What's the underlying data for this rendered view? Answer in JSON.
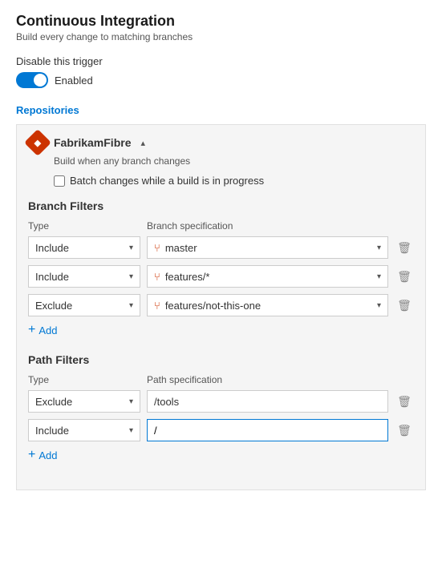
{
  "header": {
    "title": "Continuous Integration",
    "subtitle": "Build every change to matching branches"
  },
  "disable_trigger": {
    "label": "Disable this trigger",
    "toggle_state": "Enabled"
  },
  "repositories_section": {
    "label": "Repositories"
  },
  "repo": {
    "name": "FabrikamFibre",
    "description": "Build when any branch changes",
    "batch_label": "Batch changes while a build is in progress",
    "branch_filters_title": "Branch Filters",
    "type_col": "Type",
    "branch_spec_col": "Branch specification",
    "filters": [
      {
        "type": "Include",
        "spec": "master"
      },
      {
        "type": "Include",
        "spec": "features/*"
      },
      {
        "type": "Exclude",
        "spec": "features/not-this-one"
      }
    ],
    "add_label": "Add",
    "path_filters_title": "Path Filters",
    "path_type_col": "Type",
    "path_spec_col": "Path specification",
    "path_filters": [
      {
        "type": "Exclude",
        "spec": "/tools"
      },
      {
        "type": "Include",
        "spec": "/"
      }
    ],
    "path_add_label": "Add"
  },
  "icons": {
    "chevron_down": "▾",
    "chevron_up": "▴",
    "plus": "+",
    "delete": "🗑",
    "branch": "⑂"
  }
}
